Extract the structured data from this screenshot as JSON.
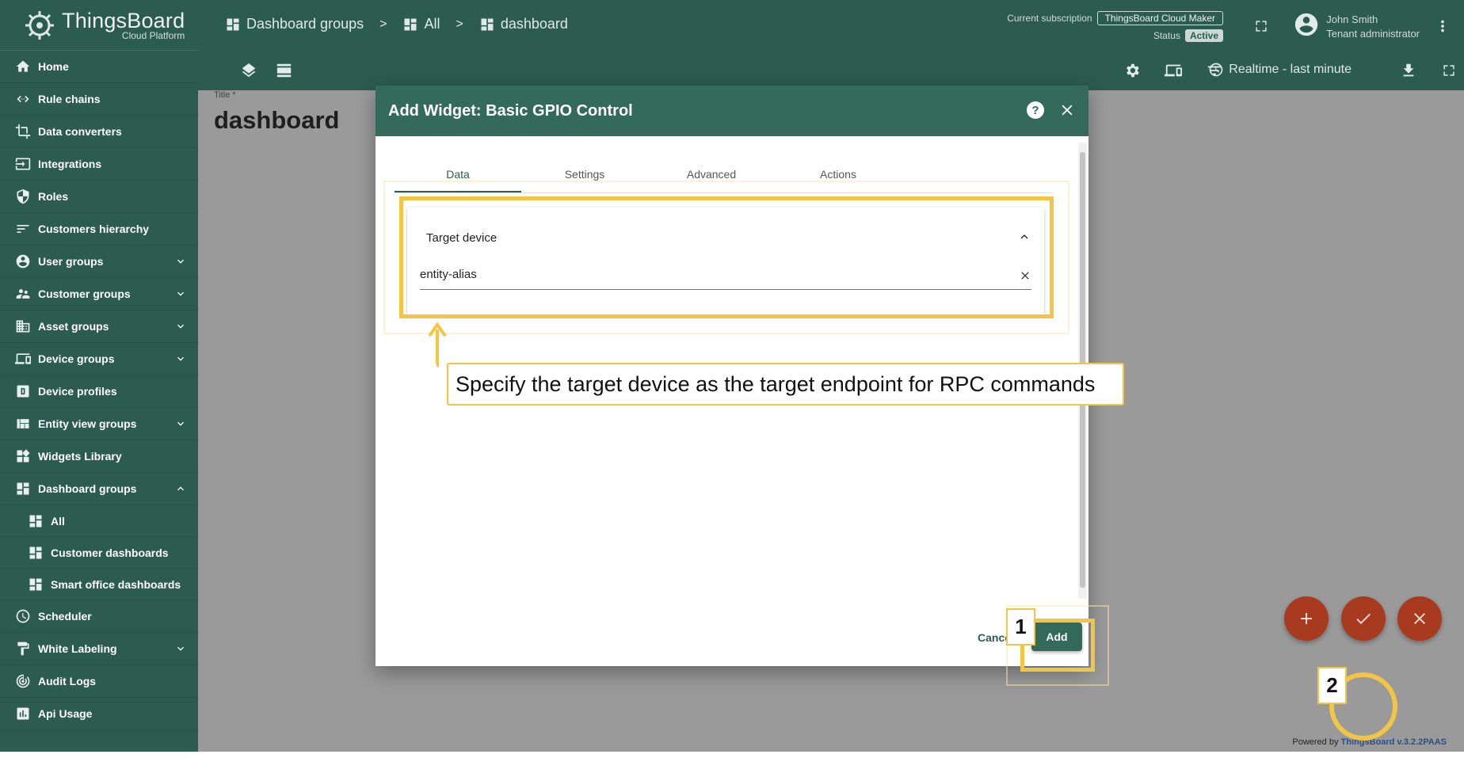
{
  "brand": {
    "title": "ThingsBoard",
    "subtitle": "Cloud Platform"
  },
  "sidebar": {
    "items": [
      {
        "label": "Home",
        "icon": "home-icon"
      },
      {
        "label": "Rule chains",
        "icon": "rule-chains-icon"
      },
      {
        "label": "Data converters",
        "icon": "crop-icon"
      },
      {
        "label": "Integrations",
        "icon": "input-icon"
      },
      {
        "label": "Roles",
        "icon": "shield-icon"
      },
      {
        "label": "Customers hierarchy",
        "icon": "sort-icon"
      },
      {
        "label": "User groups",
        "icon": "account-circle-icon"
      },
      {
        "label": "Customer groups",
        "icon": "supervisor-icon"
      },
      {
        "label": "Asset groups",
        "icon": "domain-icon"
      },
      {
        "label": "Device groups",
        "icon": "devices-icon"
      },
      {
        "label": "Device profiles",
        "icon": "device-profile-icon"
      },
      {
        "label": "Entity view groups",
        "icon": "view-quilt-icon"
      },
      {
        "label": "Widgets Library",
        "icon": "widgets-icon"
      },
      {
        "label": "Dashboard groups",
        "icon": "dashboard-icon"
      },
      {
        "label": "All",
        "icon": "dashboard-icon"
      },
      {
        "label": "Customer dashboards",
        "icon": "dashboard-icon"
      },
      {
        "label": "Smart office dashboards",
        "icon": "dashboard-icon"
      },
      {
        "label": "Scheduler",
        "icon": "clock-icon"
      },
      {
        "label": "White Labeling",
        "icon": "format-paint-icon"
      },
      {
        "label": "Audit Logs",
        "icon": "track-changes-icon"
      },
      {
        "label": "Api Usage",
        "icon": "insert-chart-icon"
      }
    ]
  },
  "header": {
    "breadcrumbs": [
      "Dashboard groups",
      "All",
      "dashboard"
    ],
    "subscription_label": "Current subscription",
    "subscription_value": "ThingsBoard Cloud Maker",
    "status_label": "Status",
    "status_value": "Active",
    "user_name": "John Smith",
    "user_role": "Tenant administrator",
    "realtime": "Realtime - last minute"
  },
  "main": {
    "title_label": "Title *",
    "title": "dashboard",
    "powered_by": "Powered by",
    "powered_link": "ThingsBoard v.3.2.2PAAS"
  },
  "dialog": {
    "title": "Add Widget: Basic GPIO Control",
    "help": "?",
    "tabs": [
      "Data",
      "Settings",
      "Advanced",
      "Actions"
    ],
    "panel_title": "Target device",
    "field_value": "entity-alias",
    "cancel": "Cancel",
    "add": "Add"
  },
  "tutorial": {
    "callout": "Specify the target device as the target endpoint for RPC commands",
    "step1": "1",
    "step2": "2",
    "accent": "#f2c544"
  },
  "colors": {
    "primary": "#2c5b4f",
    "fab": "#a83a1f"
  }
}
